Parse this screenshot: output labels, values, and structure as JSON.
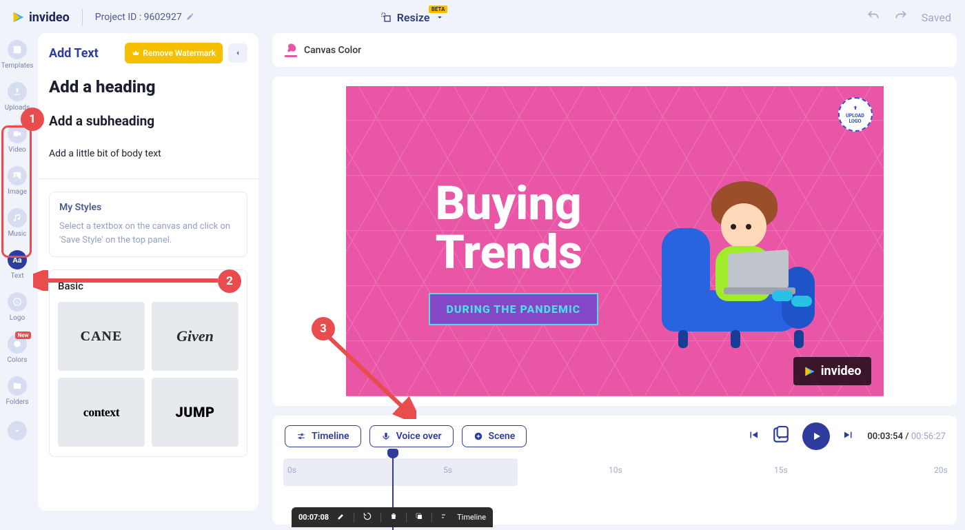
{
  "brand": "invideo",
  "projectIdLabel": "Project ID : 9602927",
  "resizeLabel": "Resize",
  "resizeBadge": "BETA",
  "savedLabel": "Saved",
  "rail": {
    "templates": "Templates",
    "uploads": "Uploads",
    "video": "Video",
    "image": "Image",
    "music": "Music",
    "text": "Text",
    "logo": "Logo",
    "colors": "Colors",
    "folders": "Folders",
    "newBadge": "New"
  },
  "panel": {
    "title": "Add Text",
    "removeWatermark": "Remove Watermark",
    "addHeading": "Add a heading",
    "addSubheading": "Add a subheading",
    "addBody": "Add a little bit of body text",
    "myStylesTitle": "My Styles",
    "myStylesDesc": "Select a textbox on the canvas and click on 'Save Style' on the top panel.",
    "basicTitle": "Basic",
    "styles": [
      "CANE",
      "Given",
      "context",
      "JUMP"
    ]
  },
  "canvasToolbar": {
    "canvasColor": "Canvas Color"
  },
  "canvas": {
    "headlineLine1": "Buying",
    "headlineLine2": "Trends",
    "subline": "DURING THE PANDEMIC",
    "uploadLogo1": "UPLOAD",
    "uploadLogo2": "LOGO",
    "watermark": "invideo"
  },
  "bottom": {
    "timeline": "Timeline",
    "voiceover": "Voice over",
    "scene": "Scene",
    "currentTime": "00:03:54",
    "totalTime": "00:56:27",
    "ruler": {
      "t0": "0s",
      "t5": "5s",
      "t10": "10s",
      "t15": "15s",
      "t20": "20s"
    },
    "clipTime": "00:07:08",
    "clipTimelineLabel": "Timeline"
  },
  "annotations": {
    "n1": "1",
    "n2": "2",
    "n3": "3"
  }
}
